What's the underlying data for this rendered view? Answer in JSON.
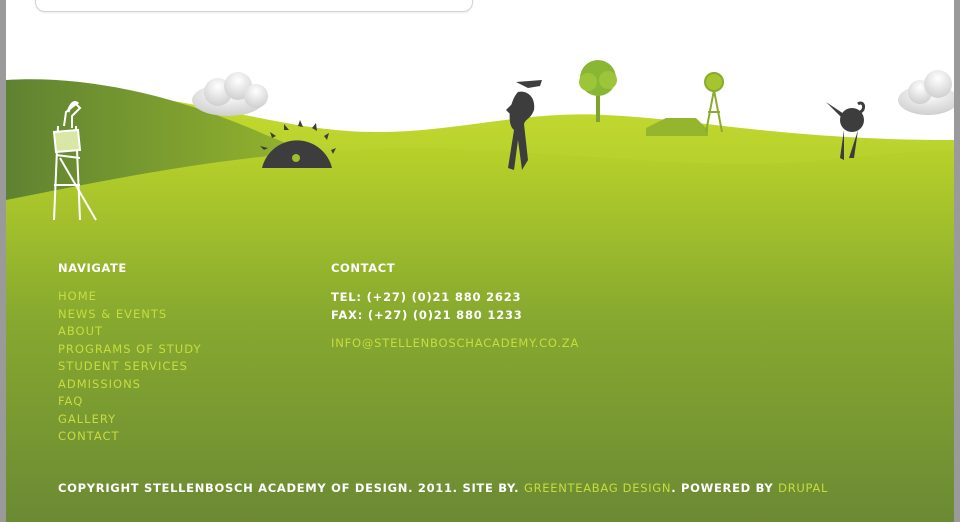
{
  "colors": {
    "frame_background": "#9a9a9a",
    "grass_dark": "#6b8a34",
    "grass_light": "#b3cf2b",
    "link_color": "#c7dc3f",
    "text_white": "#ffffff",
    "silhouette": "#3d3d3d"
  },
  "scene": {
    "icons": [
      "cloud-icon",
      "gramophone-tower-icon",
      "saw-blade-icon",
      "figure-with-horn-icon",
      "tree-icon",
      "farmhouse-icon",
      "windmill-icon",
      "watering-can-figure-icon"
    ]
  },
  "navigate": {
    "heading": "NAVIGATE",
    "items": [
      {
        "label": "HOME"
      },
      {
        "label": "NEWS & EVENTS"
      },
      {
        "label": "ABOUT"
      },
      {
        "label": "PROGRAMS OF STUDY"
      },
      {
        "label": "STUDENT SERVICES"
      },
      {
        "label": "ADMISSIONS"
      },
      {
        "label": "FAQ"
      },
      {
        "label": "GALLERY"
      },
      {
        "label": "CONTACT"
      }
    ]
  },
  "contact": {
    "heading": "CONTACT",
    "tel": "TEL: (+27) (0)21 880 2623",
    "fax": "FAX: (+27) (0)21 880 1233",
    "email": "INFO@STELLENBOSCHACADEMY.CO.ZA"
  },
  "footer": {
    "copyright_prefix": "COPYRIGHT STELLENBOSCH ACADEMY OF DESIGN. 2011. SITE BY. ",
    "site_by_link": "GREENTEABAG DESIGN",
    "powered_text": ". POWERED BY ",
    "powered_link": "DRUPAL"
  }
}
